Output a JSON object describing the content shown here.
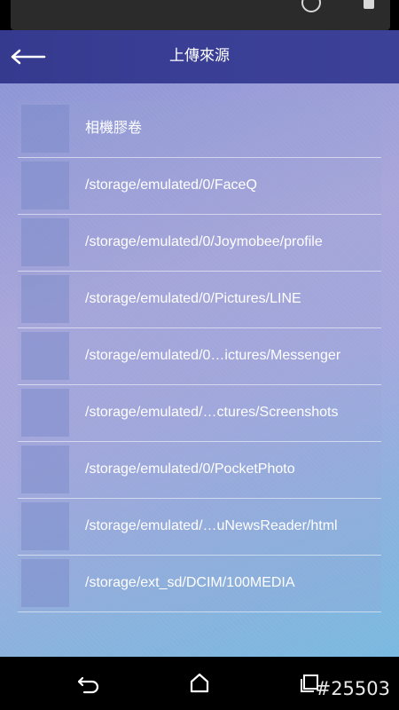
{
  "status_bar": {
    "time_fragment": "",
    "sub_fragment": ""
  },
  "app_bar": {
    "title": "上傳來源",
    "back_icon": "arrow-left-icon"
  },
  "folders": [
    {
      "label": "相機膠卷"
    },
    {
      "label": "/storage/emulated/0/FaceQ"
    },
    {
      "label": "/storage/emulated/0/Joymobee/profile"
    },
    {
      "label": "/storage/emulated/0/Pictures/LINE"
    },
    {
      "label": "/storage/emulated/0…ictures/Messenger"
    },
    {
      "label": "/storage/emulated/…ctures/Screenshots"
    },
    {
      "label": "/storage/emulated/0/PocketPhoto"
    },
    {
      "label": "/storage/emulated/…uNewsReader/html"
    },
    {
      "label": "/storage/ext_sd/DCIM/100MEDIA"
    }
  ],
  "nav_bar": {
    "back_icon": "nav-back-icon",
    "home_icon": "home-icon",
    "recents_icon": "recent-apps-icon",
    "watermark": "#25503"
  },
  "colors": {
    "app_bar": "#383d93",
    "text": "#ffffff"
  }
}
